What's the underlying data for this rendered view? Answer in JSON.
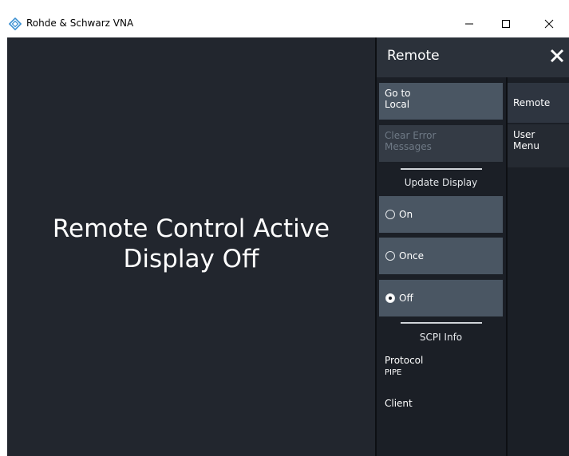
{
  "window": {
    "title": "Rohde & Schwarz VNA",
    "minimize": "—",
    "maximize": "☐",
    "close": "✕"
  },
  "main": {
    "line1": "Remote Control Active",
    "line2": "Display Off"
  },
  "panel": {
    "title": "Remote",
    "close": "✕",
    "buttons": [
      {
        "label_line1": "Go to",
        "label_line2": "Local",
        "enabled": true
      },
      {
        "label_line1": "Clear Error",
        "label_line2": "Messages",
        "enabled": false
      }
    ],
    "update_display": {
      "label": "Update Display",
      "options": [
        {
          "label": "On",
          "selected": false
        },
        {
          "label": "Once",
          "selected": false
        },
        {
          "label": "Off",
          "selected": true
        }
      ]
    },
    "scpi_info": {
      "label": "SCPI Info",
      "protocol_label": "Protocol",
      "protocol_value": "PIPE",
      "client_label": "Client"
    }
  },
  "tabs": [
    {
      "line1": "Remote",
      "line2": ""
    },
    {
      "line1": "User",
      "line2": "Menu"
    }
  ]
}
